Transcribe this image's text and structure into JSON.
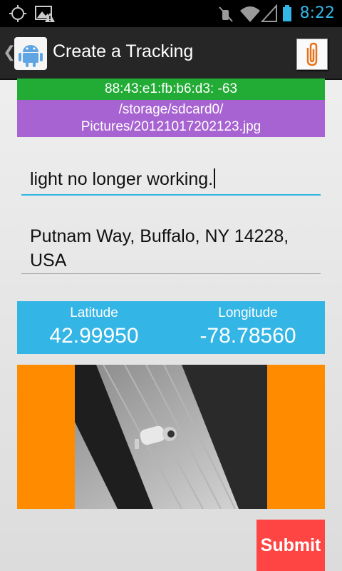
{
  "status_bar": {
    "time": "8:22",
    "icons": [
      "gps-icon",
      "image-alert-icon",
      "mute-icon",
      "wifi-icon",
      "signal-icon",
      "battery-icon"
    ]
  },
  "action_bar": {
    "title": "Create a Tracking",
    "app_icon": "android-icon",
    "action_icon": "paperclip-icon"
  },
  "info": {
    "mac_signal": "88:43:e1:fb:b6:d3: -63",
    "photo_path_line1": "/storage/sdcard0/",
    "photo_path_line2": "Pictures/20121017202123.jpg"
  },
  "form": {
    "description": "light no longer working.",
    "address_line1": "Putnam Way, Buffalo, NY 14228,",
    "address_line2": "USA"
  },
  "coordinates": {
    "latitude_label": "Latitude",
    "latitude": "42.99950",
    "longitude_label": "Longitude",
    "longitude": "-78.78560"
  },
  "submit_label": "Submit",
  "colors": {
    "mac_banner": "#22ac36",
    "path_banner": "#a863d2",
    "coords_panel": "#33b5e5",
    "photo_frame": "#ff8c00",
    "submit": "#ff4444"
  }
}
